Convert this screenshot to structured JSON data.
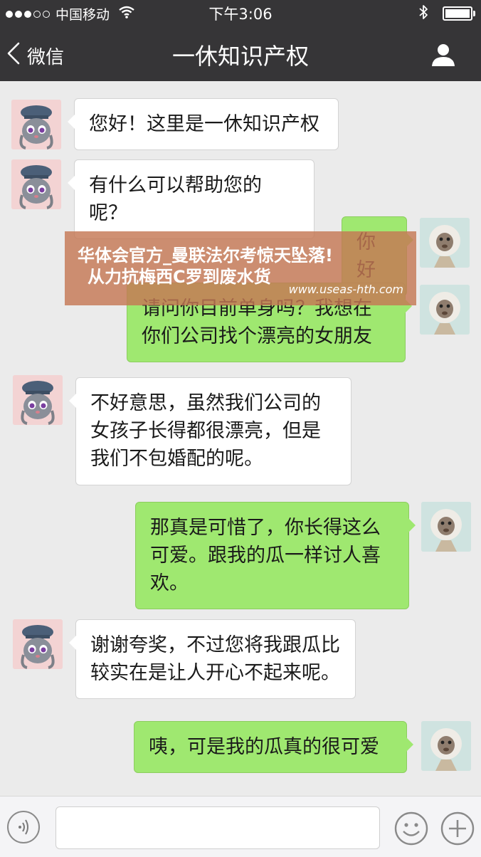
{
  "status_bar": {
    "carrier": "中国移动",
    "time": "下午3:06"
  },
  "nav": {
    "back_label": "微信",
    "title": "一休知识产权"
  },
  "messages": [
    {
      "side": "left",
      "avatar": "bunny-officer-avatar",
      "text": "您好！这里是一休知识产权"
    },
    {
      "side": "left",
      "avatar": "bunny-officer-avatar",
      "text": "有什么可以帮助您的呢？"
    },
    {
      "side": "right",
      "avatar": "white-monkey-avatar",
      "text": "你好"
    },
    {
      "side": "right",
      "avatar": "white-monkey-avatar",
      "text": "请问你目前单身吗？我想在你们公司找个漂亮的女朋友"
    },
    {
      "side": "left",
      "avatar": "bunny-officer-avatar",
      "text": "不好意思，虽然我们公司的女孩子长得都很漂亮，但是我们不包婚配的呢。"
    },
    {
      "side": "right",
      "avatar": "white-monkey-avatar",
      "text": "那真是可惜了，你长得这么可爱。跟我的瓜一样讨人喜欢。"
    },
    {
      "side": "left",
      "avatar": "bunny-officer-avatar",
      "text": "谢谢夸奖，不过您将我跟瓜比较实在是让人开心不起来呢。"
    },
    {
      "side": "right",
      "avatar": "white-monkey-avatar",
      "text": "咦，可是我的瓜真的很可爱"
    }
  ],
  "banner": {
    "line1": "华体会官方_曼联法尔考惊天坠落!",
    "line2": "从力抗梅西C罗到废水货",
    "url": "www.useas-hth.com"
  },
  "colors": {
    "nav_bg": "#363537",
    "chat_bg": "#ebebeb",
    "bubble_sent": "#9fe870",
    "bubble_received": "#ffffff",
    "banner": "#c47854"
  }
}
